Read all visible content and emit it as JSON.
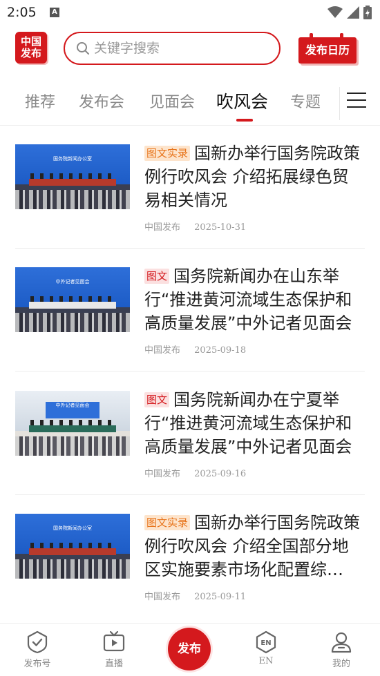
{
  "status_bar": {
    "time": "2:05",
    "notification_letter": "A"
  },
  "header": {
    "logo_line1": "中国",
    "logo_line2": "发布",
    "search_placeholder": "关键字搜索",
    "calendar_label": "发布日历"
  },
  "tabs": [
    {
      "label": "推荐",
      "active": false
    },
    {
      "label": "发布会",
      "active": false
    },
    {
      "label": "见面会",
      "active": false
    },
    {
      "label": "吹风会",
      "active": true
    },
    {
      "label": "专题",
      "active": false
    }
  ],
  "articles": [
    {
      "tag": "图文实录",
      "tag_style": "orange",
      "title": "国新办举行国务院政策例行吹风会 介绍拓展绿色贸易相关情况",
      "source": "中国发布",
      "date": "2025-10-31",
      "thumb_banner": "国务院新闻办公室"
    },
    {
      "tag": "图文",
      "tag_style": "red",
      "title": "国务院新闻办在山东举行“推进黄河流域生态保护和高质量发展”中外记者见面会",
      "source": "中国发布",
      "date": "2025-09-18",
      "thumb_banner": "中外记者见面会"
    },
    {
      "tag": "图文",
      "tag_style": "red",
      "title": "国务院新闻办在宁夏举行“推进黄河流域生态保护和高质量发展”中外记者见面会",
      "source": "中国发布",
      "date": "2025-09-16",
      "thumb_banner": "中外记者见面会"
    },
    {
      "tag": "图文实录",
      "tag_style": "orange",
      "title": "国新办举行国务院政策例行吹风会 介绍全国部分地区实施要素市场化配置综…",
      "source": "中国发布",
      "date": "2025-09-11",
      "thumb_banner": "国务院新闻办公室"
    }
  ],
  "bottom_nav": {
    "items": [
      {
        "label": "发布号",
        "icon": "shield-check-icon"
      },
      {
        "label": "直播",
        "icon": "tv-icon"
      },
      {
        "label": "EN",
        "icon": "en-hexagon-icon"
      },
      {
        "label": "我的",
        "icon": "person-icon"
      }
    ],
    "center_label": "发布"
  },
  "colors": {
    "brand_red": "#d4191d",
    "tag_orange": "#e8751c"
  }
}
